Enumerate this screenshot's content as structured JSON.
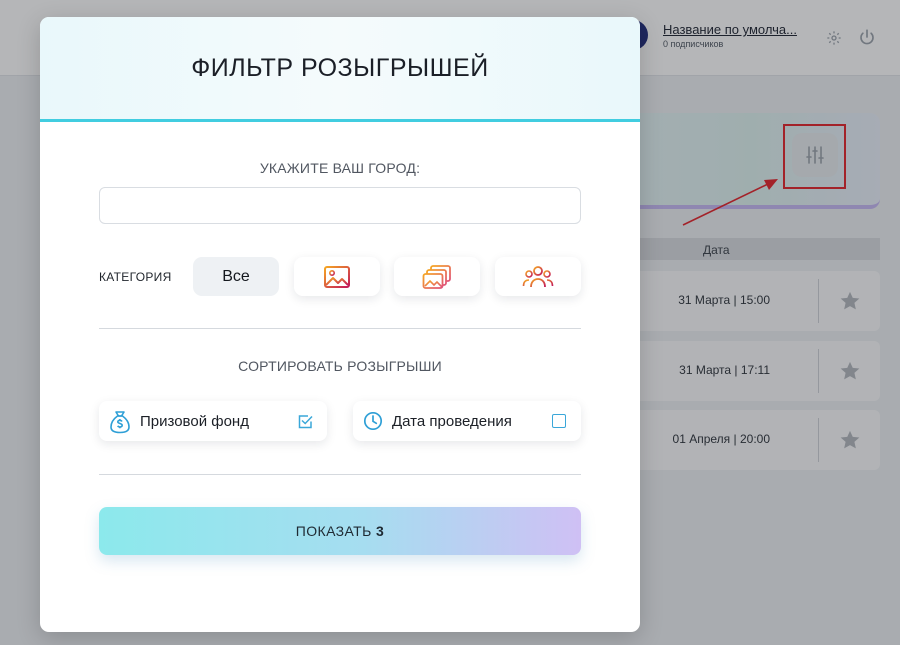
{
  "background": {
    "channel_name": "Название по умолча...",
    "subscribers": "0 подписчиков",
    "table_header_date": "Дата",
    "rows": [
      {
        "date": "31 Марта | 15:00"
      },
      {
        "date": "31 Марта | 17:11"
      },
      {
        "date": "01 Апреля | 20:00"
      }
    ],
    "icons": [
      "gear-icon",
      "power-icon",
      "filter-sliders-icon",
      "star-icon"
    ]
  },
  "modal": {
    "title": "ФИЛЬТР РОЗЫГРЫШЕЙ",
    "city_label": "УКАЖИТЕ ВАШ ГОРОД:",
    "city_value": "",
    "city_placeholder": "",
    "category_label": "КАТЕГОРИЯ",
    "categories": [
      {
        "label": "Все",
        "active": true
      },
      {
        "icon": "image-icon"
      },
      {
        "icon": "images-stack-icon"
      },
      {
        "icon": "people-icon"
      }
    ],
    "sort_label": "СОРТИРОВАТЬ РОЗЫГРЫШИ",
    "sort_options": [
      {
        "label": "Призовой фонд",
        "icon": "money-bag-icon",
        "checked": true
      },
      {
        "label": "Дата проведения",
        "icon": "clock-icon",
        "checked": false
      }
    ],
    "show_button_text": "ПОКАЗАТЬ",
    "show_button_count": "3"
  },
  "colors": {
    "accent": "#41cde0",
    "checkbox": "#3aa7d9",
    "highlight": "#e5232a",
    "icon_gradient_start": "#f5a623",
    "icon_gradient_end": "#c2185b"
  }
}
